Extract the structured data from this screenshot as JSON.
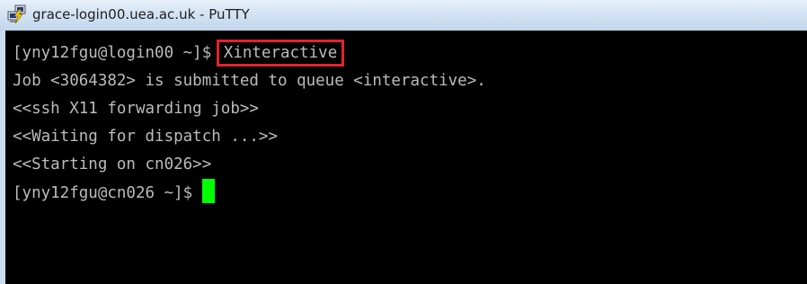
{
  "window": {
    "title": "grace-login00.uea.ac.uk - PuTTY",
    "icon": "putty-icon"
  },
  "terminal": {
    "background": "#000000",
    "foreground": "#bbbbbb",
    "cursor_color": "#00ff00",
    "highlight_color": "#e3222f",
    "lines": [
      {
        "prompt": "[yny12fgu@login00 ~]$ ",
        "command": "Xinteractive"
      },
      {
        "text": "Job <3064382> is submitted to queue <interactive>."
      },
      {
        "text": "<<ssh X11 forwarding job>>"
      },
      {
        "text": "<<Waiting for dispatch ...>>"
      },
      {
        "text": "<<Starting on cn026>>"
      },
      {
        "prompt": "[yny12fgu@cn026 ~]$ "
      }
    ]
  }
}
